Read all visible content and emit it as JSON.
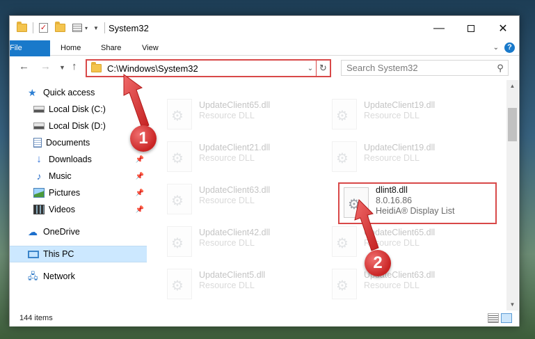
{
  "window": {
    "title": "System32"
  },
  "ribbon": {
    "tabs": [
      {
        "label": "File"
      },
      {
        "label": "Home"
      },
      {
        "label": "Share"
      },
      {
        "label": "View"
      }
    ]
  },
  "nav": {
    "address": "C:\\Windows\\System32",
    "search_placeholder": "Search System32"
  },
  "sidebar": {
    "items": [
      {
        "label": "Quick access",
        "icon": "star-icon"
      },
      {
        "label": "Local Disk (C:)",
        "icon": "drive-icon"
      },
      {
        "label": "Local Disk (D:)",
        "icon": "drive-icon"
      },
      {
        "label": "Documents",
        "icon": "documents-icon"
      },
      {
        "label": "Downloads",
        "icon": "download-icon",
        "pinned": true
      },
      {
        "label": "Music",
        "icon": "music-icon",
        "pinned": true
      },
      {
        "label": "Pictures",
        "icon": "pictures-icon",
        "pinned": true
      },
      {
        "label": "Videos",
        "icon": "videos-icon",
        "pinned": true
      },
      {
        "label": "OneDrive",
        "icon": "cloud-icon"
      },
      {
        "label": "This PC",
        "icon": "computer-icon",
        "selected": true
      },
      {
        "label": "Network",
        "icon": "network-icon"
      }
    ]
  },
  "files": [
    {
      "name": "UpdateClient65.dll",
      "desc": "Resource DLL"
    },
    {
      "name": "UpdateClient19.dll",
      "desc": "Resource DLL"
    },
    {
      "name": "UpdateClient21.dll",
      "desc": "Resource DLL"
    },
    {
      "name": "UpdateClient19.dll",
      "desc": "Resource DLL"
    },
    {
      "name": "UpdateClient63.dll",
      "desc": "Resource DLL"
    },
    {
      "name": "dlint8.dll",
      "version": "8.0.16.86",
      "desc": "HeidiA® Display List",
      "highlighted": true
    },
    {
      "name": "UpdateClient42.dll",
      "desc": "Resource DLL"
    },
    {
      "name": "UpdateClient65.dll",
      "desc": "Resource DLL"
    },
    {
      "name": "UpdateClient5.dll",
      "desc": "Resource DLL"
    },
    {
      "name": "UpdateClient63.dll",
      "desc": "Resource DLL"
    }
  ],
  "status": {
    "item_count": "144 items"
  },
  "annotations": [
    {
      "label": "1"
    },
    {
      "label": "2"
    }
  ],
  "colors": {
    "accent": "#1979ca",
    "highlight": "#d84848",
    "selection": "#cce8ff"
  }
}
